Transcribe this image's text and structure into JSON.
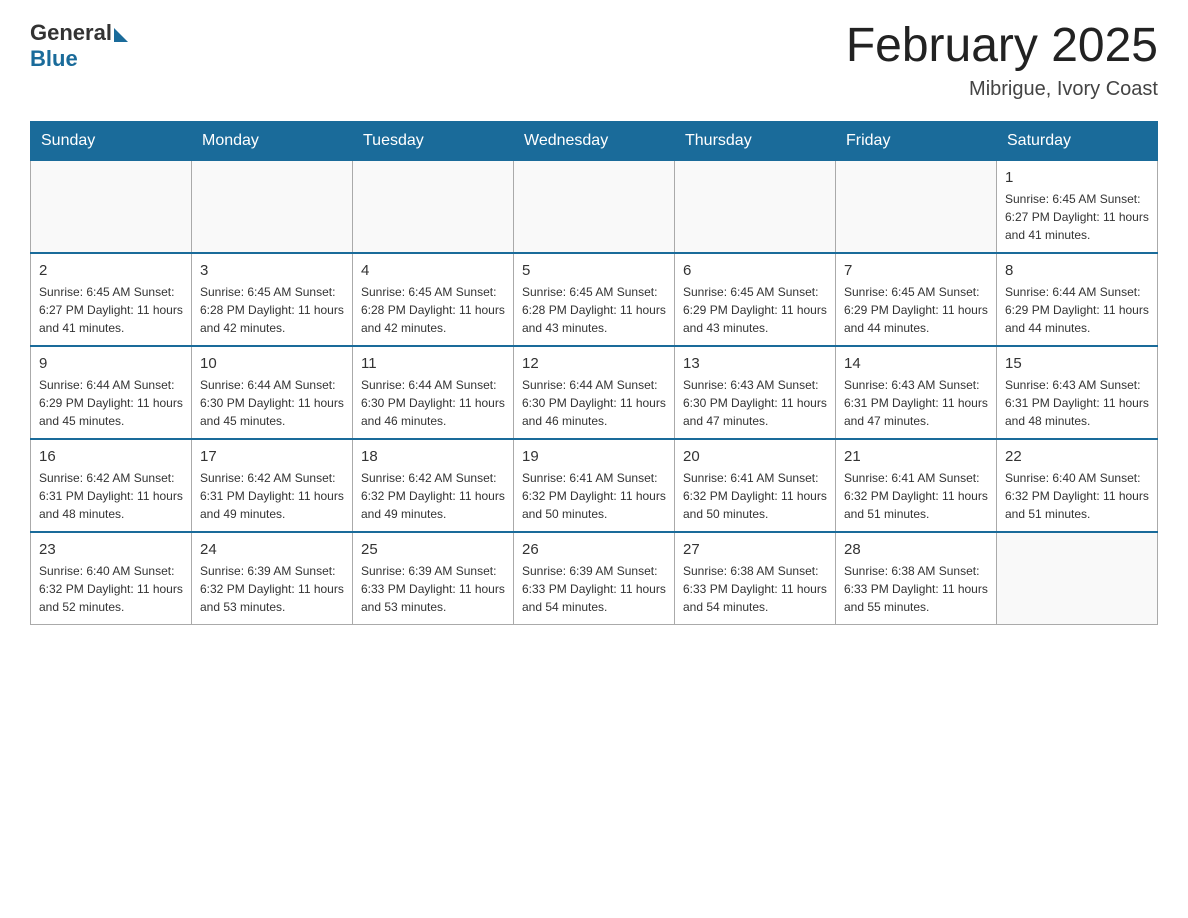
{
  "header": {
    "logo": {
      "general": "General",
      "blue": "Blue"
    },
    "title": "February 2025",
    "location": "Mibrigue, Ivory Coast"
  },
  "days_of_week": [
    "Sunday",
    "Monday",
    "Tuesday",
    "Wednesday",
    "Thursday",
    "Friday",
    "Saturday"
  ],
  "weeks": [
    [
      {
        "day": "",
        "info": ""
      },
      {
        "day": "",
        "info": ""
      },
      {
        "day": "",
        "info": ""
      },
      {
        "day": "",
        "info": ""
      },
      {
        "day": "",
        "info": ""
      },
      {
        "day": "",
        "info": ""
      },
      {
        "day": "1",
        "info": "Sunrise: 6:45 AM\nSunset: 6:27 PM\nDaylight: 11 hours and 41 minutes."
      }
    ],
    [
      {
        "day": "2",
        "info": "Sunrise: 6:45 AM\nSunset: 6:27 PM\nDaylight: 11 hours and 41 minutes."
      },
      {
        "day": "3",
        "info": "Sunrise: 6:45 AM\nSunset: 6:28 PM\nDaylight: 11 hours and 42 minutes."
      },
      {
        "day": "4",
        "info": "Sunrise: 6:45 AM\nSunset: 6:28 PM\nDaylight: 11 hours and 42 minutes."
      },
      {
        "day": "5",
        "info": "Sunrise: 6:45 AM\nSunset: 6:28 PM\nDaylight: 11 hours and 43 minutes."
      },
      {
        "day": "6",
        "info": "Sunrise: 6:45 AM\nSunset: 6:29 PM\nDaylight: 11 hours and 43 minutes."
      },
      {
        "day": "7",
        "info": "Sunrise: 6:45 AM\nSunset: 6:29 PM\nDaylight: 11 hours and 44 minutes."
      },
      {
        "day": "8",
        "info": "Sunrise: 6:44 AM\nSunset: 6:29 PM\nDaylight: 11 hours and 44 minutes."
      }
    ],
    [
      {
        "day": "9",
        "info": "Sunrise: 6:44 AM\nSunset: 6:29 PM\nDaylight: 11 hours and 45 minutes."
      },
      {
        "day": "10",
        "info": "Sunrise: 6:44 AM\nSunset: 6:30 PM\nDaylight: 11 hours and 45 minutes."
      },
      {
        "day": "11",
        "info": "Sunrise: 6:44 AM\nSunset: 6:30 PM\nDaylight: 11 hours and 46 minutes."
      },
      {
        "day": "12",
        "info": "Sunrise: 6:44 AM\nSunset: 6:30 PM\nDaylight: 11 hours and 46 minutes."
      },
      {
        "day": "13",
        "info": "Sunrise: 6:43 AM\nSunset: 6:30 PM\nDaylight: 11 hours and 47 minutes."
      },
      {
        "day": "14",
        "info": "Sunrise: 6:43 AM\nSunset: 6:31 PM\nDaylight: 11 hours and 47 minutes."
      },
      {
        "day": "15",
        "info": "Sunrise: 6:43 AM\nSunset: 6:31 PM\nDaylight: 11 hours and 48 minutes."
      }
    ],
    [
      {
        "day": "16",
        "info": "Sunrise: 6:42 AM\nSunset: 6:31 PM\nDaylight: 11 hours and 48 minutes."
      },
      {
        "day": "17",
        "info": "Sunrise: 6:42 AM\nSunset: 6:31 PM\nDaylight: 11 hours and 49 minutes."
      },
      {
        "day": "18",
        "info": "Sunrise: 6:42 AM\nSunset: 6:32 PM\nDaylight: 11 hours and 49 minutes."
      },
      {
        "day": "19",
        "info": "Sunrise: 6:41 AM\nSunset: 6:32 PM\nDaylight: 11 hours and 50 minutes."
      },
      {
        "day": "20",
        "info": "Sunrise: 6:41 AM\nSunset: 6:32 PM\nDaylight: 11 hours and 50 minutes."
      },
      {
        "day": "21",
        "info": "Sunrise: 6:41 AM\nSunset: 6:32 PM\nDaylight: 11 hours and 51 minutes."
      },
      {
        "day": "22",
        "info": "Sunrise: 6:40 AM\nSunset: 6:32 PM\nDaylight: 11 hours and 51 minutes."
      }
    ],
    [
      {
        "day": "23",
        "info": "Sunrise: 6:40 AM\nSunset: 6:32 PM\nDaylight: 11 hours and 52 minutes."
      },
      {
        "day": "24",
        "info": "Sunrise: 6:39 AM\nSunset: 6:32 PM\nDaylight: 11 hours and 53 minutes."
      },
      {
        "day": "25",
        "info": "Sunrise: 6:39 AM\nSunset: 6:33 PM\nDaylight: 11 hours and 53 minutes."
      },
      {
        "day": "26",
        "info": "Sunrise: 6:39 AM\nSunset: 6:33 PM\nDaylight: 11 hours and 54 minutes."
      },
      {
        "day": "27",
        "info": "Sunrise: 6:38 AM\nSunset: 6:33 PM\nDaylight: 11 hours and 54 minutes."
      },
      {
        "day": "28",
        "info": "Sunrise: 6:38 AM\nSunset: 6:33 PM\nDaylight: 11 hours and 55 minutes."
      },
      {
        "day": "",
        "info": ""
      }
    ]
  ]
}
